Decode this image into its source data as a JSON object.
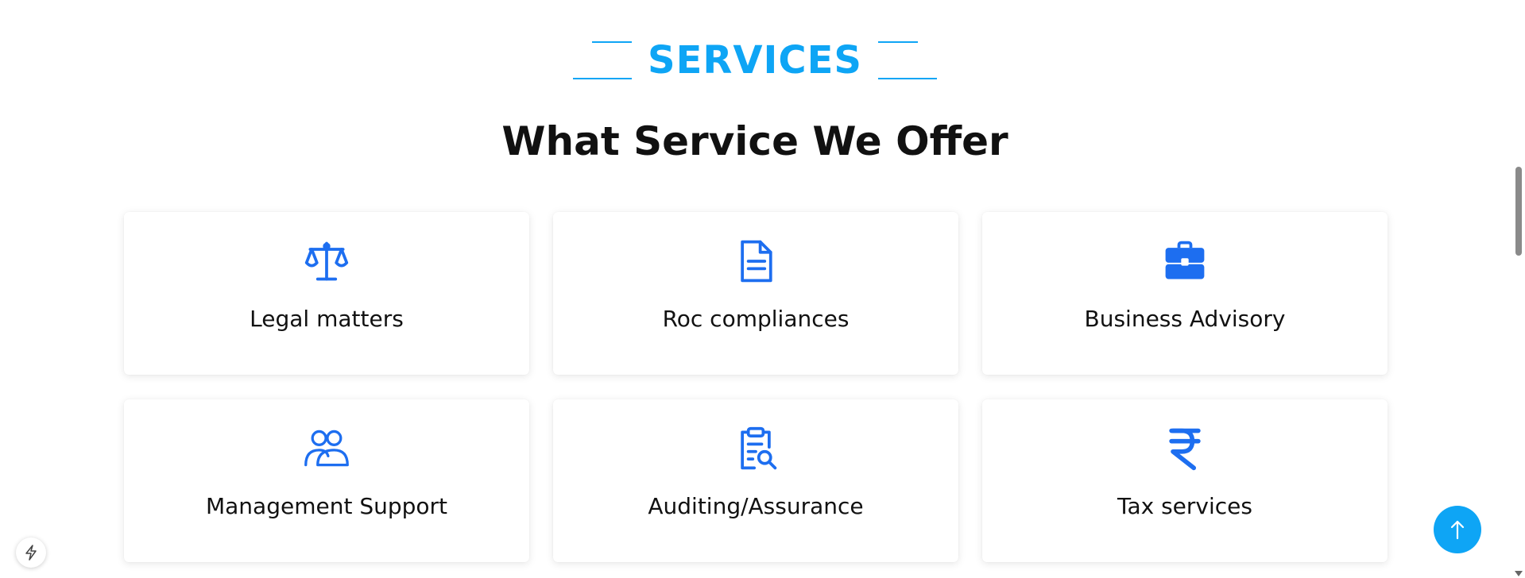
{
  "section": {
    "eyebrow": "SERVICES",
    "heading": "What Service We Offer"
  },
  "services": [
    {
      "title": "Legal matters",
      "icon": "scales-icon"
    },
    {
      "title": "Roc compliances",
      "icon": "document-icon"
    },
    {
      "title": "Business Advisory",
      "icon": "briefcase-icon"
    },
    {
      "title": "Management Support",
      "icon": "users-icon"
    },
    {
      "title": "Auditing/Assurance",
      "icon": "clipboard-search-icon"
    },
    {
      "title": "Tax services",
      "icon": "rupee-icon"
    }
  ],
  "colors": {
    "accent": "#0ea5f5",
    "icon": "#1d6ef0",
    "heading": "#111111"
  }
}
